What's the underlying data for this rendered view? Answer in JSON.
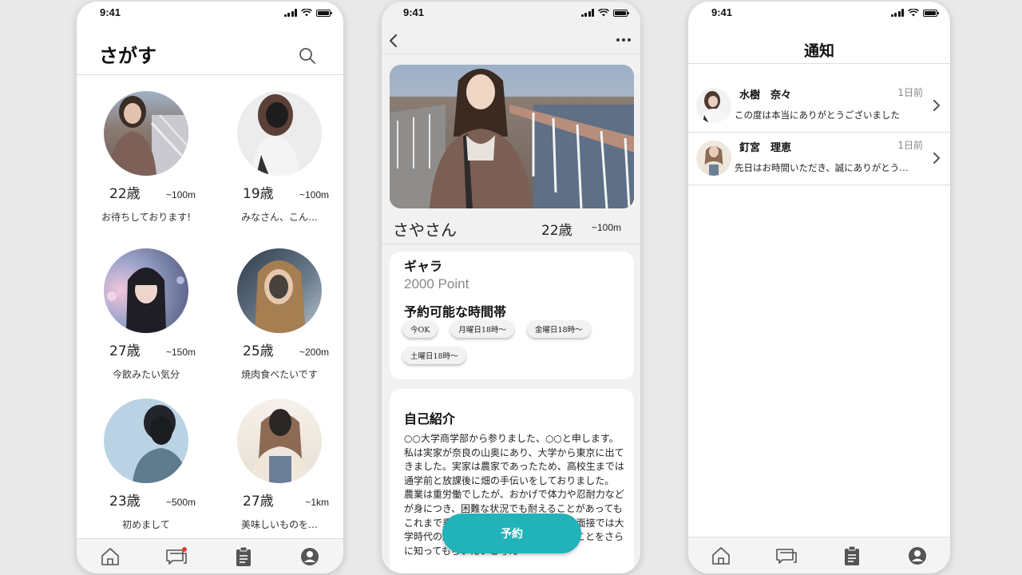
{
  "status": {
    "time": "9:41"
  },
  "search_screen": {
    "title": "さがす",
    "search_icon": "search-icon",
    "profiles": [
      {
        "age": "22歳",
        "distance": "~100m",
        "message": "お待ちしております!"
      },
      {
        "age": "19歳",
        "distance": "~100m",
        "message": "みなさん、こん…"
      },
      {
        "age": "27歳",
        "distance": "~150m",
        "message": "今飲みたい気分"
      },
      {
        "age": "25歳",
        "distance": "~200m",
        "message": "焼肉食べたいです"
      },
      {
        "age": "23歳",
        "distance": "~500m",
        "message": "初めまして"
      },
      {
        "age": "27歳",
        "distance": "~1km",
        "message": "美味しいものを…"
      }
    ],
    "tabbar": [
      "home-icon",
      "chat-icon",
      "clipboard-icon",
      "profile-icon"
    ]
  },
  "profile_screen": {
    "name": "さやさん",
    "age": "22歳",
    "distance": "~100m",
    "fee_title": "ギャラ",
    "fee_value": "2000 Point",
    "slots_title": "予約可能な時間帯",
    "slots": [
      "今OK",
      "月曜日18時〜",
      "金曜日18時〜",
      "土曜日18時〜"
    ],
    "intro_title": "自己紹介",
    "intro_text": "○○大学商学部から参りました、○○と申します。私は実家が奈良の山奥にあり、大学から東京に出てきました。実家は農家であったため、高校生までは通学前と放課後に畑の手伝いをしておりました。\n農業は重労働でしたが、おかげで体力や忍耐力などが身につき、困難な状況でも耐えることがあってもこれまで乗り越えることが出来ました。面接では大学時代の経験などをアピールして、私のことをさらに知ってもらいたいと考え",
    "reserve_label": "予約"
  },
  "notifications_screen": {
    "title": "通知",
    "items": [
      {
        "name": "水樹　奈々",
        "time": "1日前",
        "text": "この度は本当にありがとうございました"
      },
      {
        "name": "釘宮　理恵",
        "time": "1日前",
        "text": "先日はお時間いただき、誠にありがとう…"
      }
    ]
  },
  "colors": {
    "accent": "#21b3b9",
    "badge": "#e53935"
  }
}
